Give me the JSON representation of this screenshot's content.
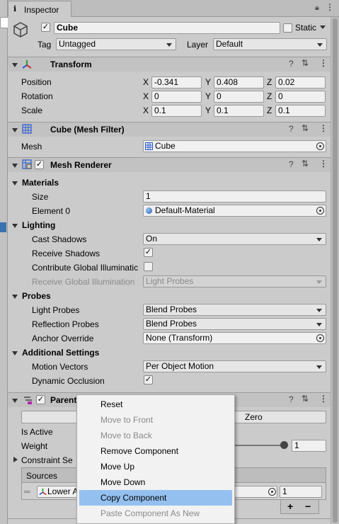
{
  "tab": {
    "title": "Inspector"
  },
  "header": {
    "name": "Cube",
    "static_label": "Static",
    "tag_label": "Tag",
    "tag_value": "Untagged",
    "layer_label": "Layer",
    "layer_value": "Default"
  },
  "transform": {
    "title": "Transform",
    "rows": [
      {
        "label": "Position",
        "x": "-0.341",
        "y": "0.408",
        "z": "0.02"
      },
      {
        "label": "Rotation",
        "x": "0",
        "y": "0",
        "z": "0"
      },
      {
        "label": "Scale",
        "x": "0.1",
        "y": "0.1",
        "z": "0.1"
      }
    ],
    "axis": {
      "x": "X",
      "y": "Y",
      "z": "Z"
    }
  },
  "mesh_filter": {
    "title": "Cube (Mesh Filter)",
    "mesh_label": "Mesh",
    "mesh_value": "Cube"
  },
  "mesh_renderer": {
    "title": "Mesh Renderer",
    "materials": {
      "title": "Materials",
      "size_label": "Size",
      "size_value": "1",
      "element_label": "Element 0",
      "element_value": "Default-Material"
    },
    "lighting": {
      "title": "Lighting",
      "cast_label": "Cast Shadows",
      "cast_value": "On",
      "receive_label": "Receive Shadows",
      "contribute_label": "Contribute Global Illuminatic",
      "rgi_label": "Receive Global Illumination",
      "rgi_value": "Light Probes"
    },
    "probes": {
      "title": "Probes",
      "light_label": "Light Probes",
      "light_value": "Blend Probes",
      "reflection_label": "Reflection Probes",
      "reflection_value": "Blend Probes",
      "anchor_label": "Anchor Override",
      "anchor_value": "None (Transform)"
    },
    "additional": {
      "title": "Additional Settings",
      "motion_label": "Motion Vectors",
      "motion_value": "Per Object Motion",
      "occlusion_label": "Dynamic Occlusion"
    }
  },
  "parent_constraint": {
    "title": "Parent",
    "zero_button": "Zero",
    "is_active_label": "Is Active",
    "weight_label": "Weight",
    "weight_value": "1",
    "constraint_label": "Constraint Se",
    "sources_label": "Sources",
    "source_name": "Lower A",
    "source_weight": "1",
    "add": "+",
    "remove": "−"
  },
  "context_menu": {
    "items": [
      {
        "label": "Reset",
        "enabled": true
      },
      {
        "label": "Move to Front",
        "enabled": false
      },
      {
        "label": "Move to Back",
        "enabled": false
      },
      {
        "label": "Remove Component",
        "enabled": true
      },
      {
        "label": "Move Up",
        "enabled": true
      },
      {
        "label": "Move Down",
        "enabled": true
      },
      {
        "label": "Copy Component",
        "enabled": true,
        "highlighted": true
      },
      {
        "label": "Paste Component As New",
        "enabled": false
      }
    ]
  },
  "colors": {
    "highlight": "#94c0f0",
    "selection": "#3a72b0",
    "panel": "#cbcbcb"
  }
}
